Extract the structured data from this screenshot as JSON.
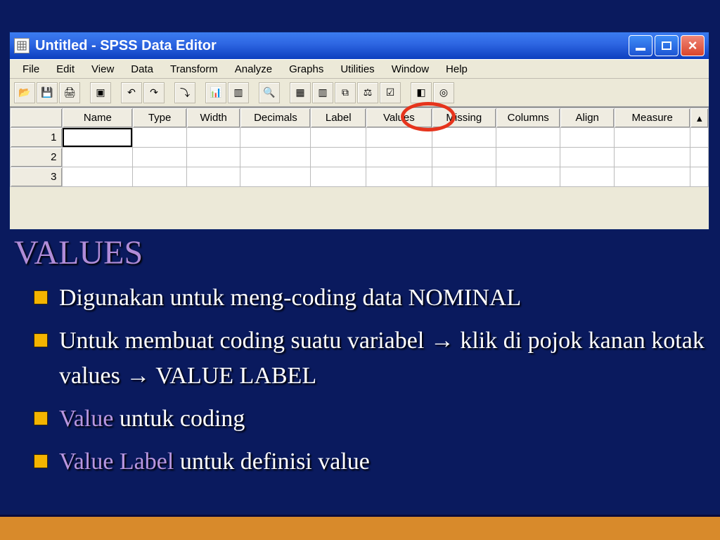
{
  "window": {
    "title": "Untitled - SPSS Data Editor"
  },
  "menu": {
    "items": [
      "File",
      "Edit",
      "View",
      "Data",
      "Transform",
      "Analyze",
      "Graphs",
      "Utilities",
      "Window",
      "Help"
    ]
  },
  "columns": [
    "Name",
    "Type",
    "Width",
    "Decimals",
    "Label",
    "Values",
    "Missing",
    "Columns",
    "Align",
    "Measure"
  ],
  "rows": [
    "1",
    "2",
    "3"
  ],
  "slide": {
    "title": "VALUES",
    "b1": "Digunakan untuk meng-coding data NOMINAL",
    "b2": "Untuk membuat coding suatu variabel → klik di pojok kanan kotak values → VALUE LABEL",
    "b3a": "Value",
    "b3b": " untuk coding",
    "b4a": "Value Label",
    "b4b": " untuk definisi value"
  },
  "icons": {
    "open": "📂",
    "save": "💾",
    "print": "🖨",
    "db": "▣",
    "undo": "↶",
    "redo": "↷",
    "goto": "⤵",
    "chart": "📊",
    "find": "🔍",
    "insert": "▦",
    "vars": "▥",
    "split": "⧉",
    "weight": "⚖",
    "select": "☑",
    "sets": "◧",
    "val": "◎"
  }
}
